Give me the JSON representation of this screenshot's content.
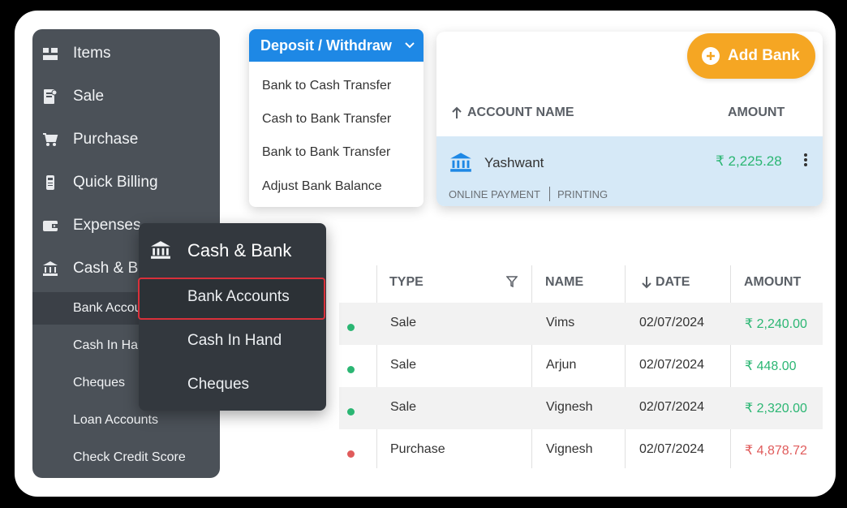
{
  "sidebar": {
    "items": [
      {
        "label": "Items",
        "icon": "items-icon"
      },
      {
        "label": "Sale",
        "icon": "sale-icon"
      },
      {
        "label": "Purchase",
        "icon": "cart-icon"
      },
      {
        "label": "Quick Billing",
        "icon": "billing-icon"
      },
      {
        "label": "Expenses",
        "icon": "wallet-icon"
      },
      {
        "label": "Cash & Bank",
        "icon": "bank-icon"
      }
    ],
    "sub_items": [
      {
        "label": "Bank Accounts"
      },
      {
        "label": "Cash In Hand"
      },
      {
        "label": "Cheques"
      },
      {
        "label": "Loan Accounts"
      },
      {
        "label": "Check Credit Score"
      }
    ]
  },
  "dropdown": {
    "title": "Deposit / Withdraw",
    "items": [
      "Bank to Cash Transfer",
      "Cash to Bank Transfer",
      "Bank to Bank Transfer",
      "Adjust Bank Balance"
    ]
  },
  "accounts": {
    "add_label": "Add Bank",
    "col_name": "ACCOUNT NAME",
    "col_amount": "AMOUNT",
    "row": {
      "name": "Yashwant",
      "amount": "₹ 2,225.28",
      "tag1": "ONLINE PAYMENT",
      "tag2": "PRINTING"
    }
  },
  "float_menu": {
    "title": "Cash & Bank",
    "items": [
      "Bank Accounts",
      "Cash In Hand",
      "Cheques"
    ]
  },
  "transactions": {
    "headers": {
      "type": "TYPE",
      "name": "NAME",
      "date": "DATE",
      "amount": "AMOUNT"
    },
    "rows": [
      {
        "type": "Sale",
        "name": "Vims",
        "date": "02/07/2024",
        "amount": "₹ 2,240.00",
        "status": "positive"
      },
      {
        "type": "Sale",
        "name": "Arjun",
        "date": "02/07/2024",
        "amount": "₹ 448.00",
        "status": "positive"
      },
      {
        "type": "Sale",
        "name": "Vignesh",
        "date": "02/07/2024",
        "amount": "₹ 2,320.00",
        "status": "positive"
      },
      {
        "type": "Purchase",
        "name": "Vignesh",
        "date": "02/07/2024",
        "amount": "₹ 4,878.72",
        "status": "negative"
      }
    ]
  },
  "colors": {
    "accent": "#1e88e5",
    "add": "#f5a623",
    "positive": "#2bb673",
    "negative": "#e05b5b",
    "sidebar": "#4b5158"
  }
}
